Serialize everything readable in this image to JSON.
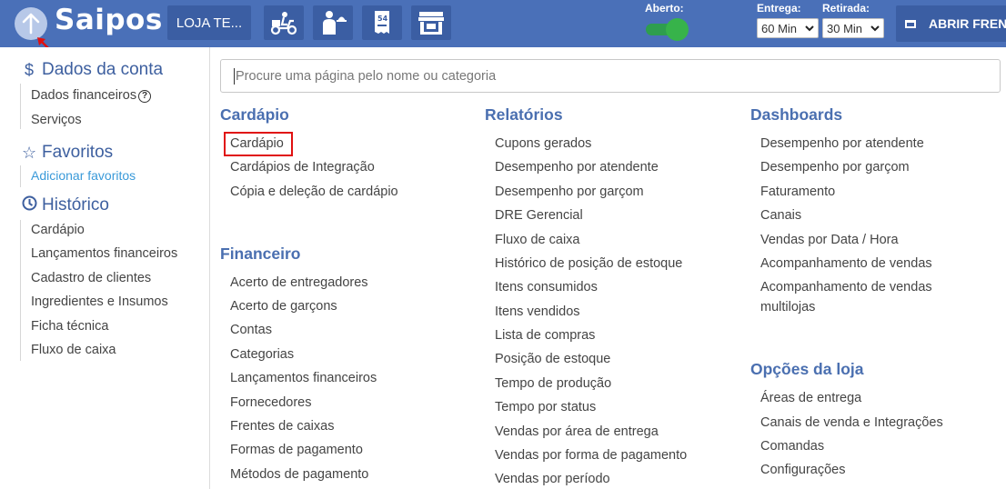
{
  "header": {
    "logo": "Saipos",
    "store_label": "LOJA TE...",
    "aberto_label": "Aberto:",
    "entrega_label": "Entrega:",
    "entrega_value": "60 Min",
    "retirada_label": "Retirada:",
    "retirada_value": "30 Min",
    "abrir_label": "ABRIR FREN",
    "icons": [
      "up-arrow-icon",
      "delivery-scooter-icon",
      "waiter-icon",
      "order-slip-icon",
      "storefront-icon"
    ],
    "colors": {
      "bar": "#4a70b8",
      "button": "#3b5ea3",
      "toggle": "#37b34a"
    }
  },
  "sidebar": {
    "dados_title": "Dados da conta",
    "dados_items": [
      "Dados financeiros",
      "Serviços"
    ],
    "favoritos_title": "Favoritos",
    "favoritos_link": "Adicionar favoritos",
    "historico_title": "Histórico",
    "historico_items": [
      "Cardápio",
      "Lançamentos financeiros",
      "Cadastro de clientes",
      "Ingredientes e Insumos",
      "Ficha técnica",
      "Fluxo de caixa"
    ]
  },
  "search": {
    "placeholder": "Procure uma página pelo nome ou categoria"
  },
  "columns": {
    "cardapio": {
      "title": "Cardápio",
      "items": [
        "Cardápio",
        "Cardápios de Integração",
        "Cópia e deleção de cardápio"
      ]
    },
    "financeiro": {
      "title": "Financeiro",
      "items": [
        "Acerto de entregadores",
        "Acerto de garçons",
        "Contas",
        "Categorias",
        "Lançamentos financeiros",
        "Fornecedores",
        "Frentes de caixas",
        "Formas de pagamento",
        "Métodos de pagamento"
      ]
    },
    "relatorios": {
      "title": "Relatórios",
      "items": [
        "Cupons gerados",
        "Desempenho por atendente",
        "Desempenho por garçom",
        "DRE Gerencial",
        "Fluxo de caixa",
        "Histórico de posição de estoque",
        "Itens consumidos",
        "Itens vendidos",
        "Lista de compras",
        "Posição de estoque",
        "Tempo de produção",
        "Tempo por status",
        "Vendas por área de entrega",
        "Vendas por forma de pagamento",
        "Vendas por período"
      ]
    },
    "dashboards": {
      "title": "Dashboards",
      "items": [
        "Desempenho por atendente",
        "Desempenho por garçom",
        "Faturamento",
        "Canais",
        "Vendas por Data / Hora",
        "Acompanhamento de vendas",
        "Acompanhamento de vendas multilojas"
      ]
    },
    "opcoes": {
      "title": "Opções da loja",
      "items": [
        "Áreas de entrega",
        "Canais de venda e Integrações",
        "Comandas",
        "Configurações"
      ]
    }
  }
}
